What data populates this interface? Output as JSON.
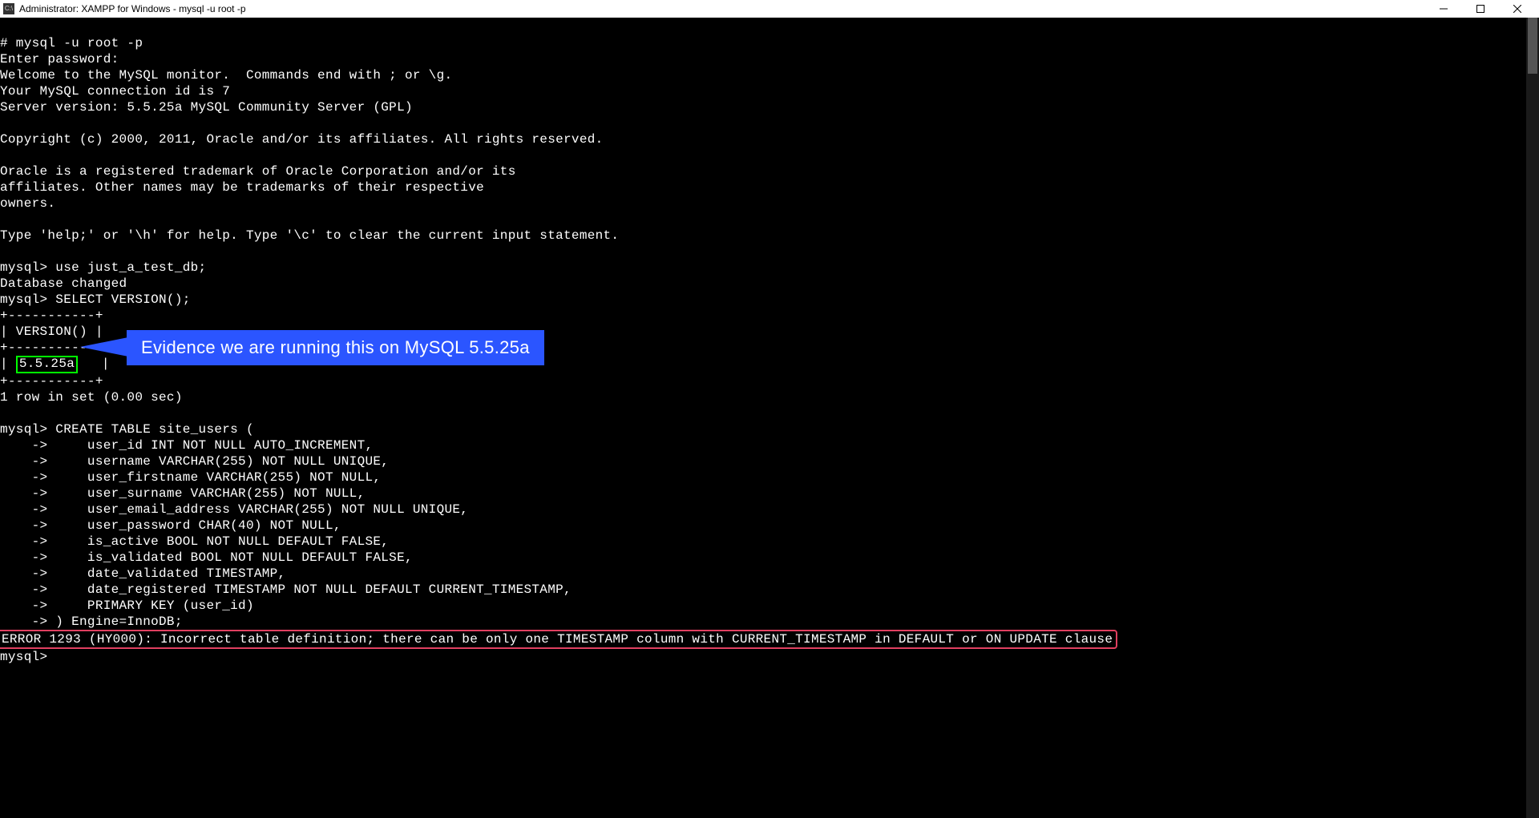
{
  "window": {
    "title": "Administrator:  XAMPP for Windows - mysql  -u root -p"
  },
  "terminal": {
    "lines": [
      "# mysql -u root -p",
      "Enter password:",
      "Welcome to the MySQL monitor.  Commands end with ; or \\g.",
      "Your MySQL connection id is 7",
      "Server version: 5.5.25a MySQL Community Server (GPL)",
      "",
      "Copyright (c) 2000, 2011, Oracle and/or its affiliates. All rights reserved.",
      "",
      "Oracle is a registered trademark of Oracle Corporation and/or its",
      "affiliates. Other names may be trademarks of their respective",
      "owners.",
      "",
      "Type 'help;' or '\\h' for help. Type '\\c' to clear the current input statement.",
      "",
      "mysql> use just_a_test_db;",
      "Database changed",
      "mysql> SELECT VERSION();",
      "+-----------+",
      "| VERSION() |",
      "+-----------+"
    ],
    "version_row_prefix": "| ",
    "version_value": "5.5.25a",
    "version_row_suffix": "   |",
    "lines2": [
      "+-----------+",
      "1 row in set (0.00 sec)",
      "",
      "mysql> CREATE TABLE site_users (",
      "    ->     user_id INT NOT NULL AUTO_INCREMENT,",
      "    ->     username VARCHAR(255) NOT NULL UNIQUE,",
      "    ->     user_firstname VARCHAR(255) NOT NULL,",
      "    ->     user_surname VARCHAR(255) NOT NULL,",
      "    ->     user_email_address VARCHAR(255) NOT NULL UNIQUE,",
      "    ->     user_password CHAR(40) NOT NULL,",
      "    ->     is_active BOOL NOT NULL DEFAULT FALSE,",
      "    ->     is_validated BOOL NOT NULL DEFAULT FALSE,",
      "    ->     date_validated TIMESTAMP,",
      "    ->     date_registered TIMESTAMP NOT NULL DEFAULT CURRENT_TIMESTAMP,",
      "    ->     PRIMARY KEY (user_id)",
      "    -> ) Engine=InnoDB;"
    ],
    "error_line": "ERROR 1293 (HY000): Incorrect table definition; there can be only one TIMESTAMP column with CURRENT_TIMESTAMP in DEFAULT or ON UPDATE clause",
    "final_prompt": "mysql>"
  },
  "annotation": {
    "callout_text": "Evidence we are running this on MySQL 5.5.25a"
  }
}
